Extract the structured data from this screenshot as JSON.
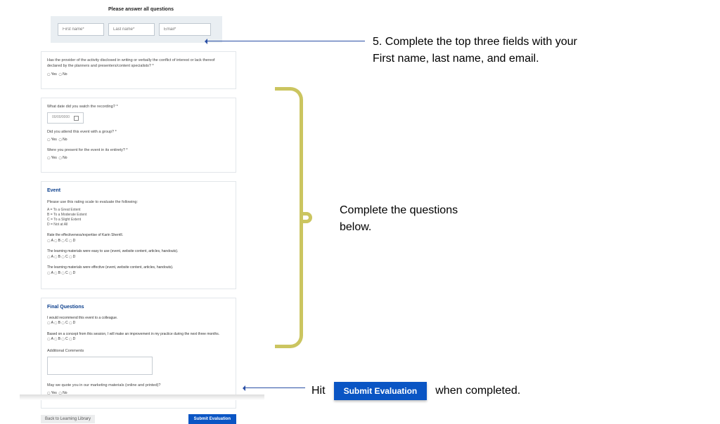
{
  "form": {
    "title": "Please answer all questions",
    "fields": {
      "first_ph": "First name*",
      "last_ph": "Last name*",
      "email_ph": "Email*"
    },
    "card1": {
      "q": "Has the provider of the activity disclosed in writing or verbally the conflict of interest or lack thereof declared by the planners and presenters/content specialists? *",
      "yes": "Yes",
      "no": "No"
    },
    "card2": {
      "q1": "What date did you watch the recording? *",
      "date_ph": "00/00/0000",
      "q2": "Did you attend this event with a group? *",
      "q3": "Were you present for the event in its entirety? *",
      "yes": "Yes",
      "no": "No"
    },
    "event": {
      "heading": "Event",
      "intro": "Please use this rating scale to evaluate the following:",
      "legend1": "A = To a Great Extent",
      "legend2": "B = To a Moderate Extent",
      "legend3": "C = To a Slight Extent",
      "legend4": "D = Not at All",
      "r1": "Rate the effectiveness/expertise of Karin Sherrill.",
      "r2": "The learning materials were easy to use (event, website content, articles, handouts).",
      "r3": "The learning materials were effective (event, website content, articles, handouts).",
      "scale": "A   B   C   D"
    },
    "final": {
      "heading": "Final Questions",
      "r1": "I would recommend this event to a colleague.",
      "r2": "Based on a concept from this session, I will make an improvement in my practice during the next three months.",
      "comments_label": "Additional Comments",
      "quote_q": "May we quote you in our marketing materials (online and printed)?",
      "yes": "Yes",
      "no": "No"
    },
    "back": "Back to Learning Library",
    "submit": "Submit Evaluation"
  },
  "annotations": {
    "step5": "5. Complete the top three fields with your First name, last name, and email.",
    "mid": "Complete the questions below.",
    "bottom_pre": "Hit",
    "bottom_post": "when completed.",
    "submit_big": "Submit Evaluation"
  }
}
